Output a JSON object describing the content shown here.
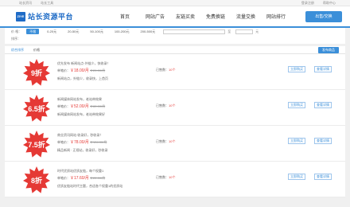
{
  "topbar": {
    "left": [
      "站长资讯",
      "站长工具"
    ],
    "right": [
      "登录注册",
      "帮助中心"
    ]
  },
  "header": {
    "logo_mark": "ZIYE",
    "logo_text": "站长资源平台",
    "nav": [
      "首页",
      "网站广告",
      "友链买卖",
      "免费换链",
      "流量交换",
      "网站排行"
    ],
    "publish_label": "出售/交换"
  },
  "filter": {
    "price_label": "价 格：",
    "price_options": [
      "不限",
      "0-20元",
      "20-50元",
      "50-100元",
      "100-200元",
      "200-500元"
    ],
    "active_index": 0,
    "range_sep": "至",
    "unit": "元",
    "sort_label": "排序："
  },
  "tabs": {
    "items": [
      "综合排序",
      "价格"
    ],
    "active_index": 0,
    "more_label": "发布商品"
  },
  "listings": [
    {
      "discount": "9折",
      "title": "优先发布 新闻站点·外链少，快收录！",
      "price_label": "单笔价：",
      "price": "￥18.00/月",
      "orig": "￥20.00/月",
      "desc": "新闻站点，外链少，收录快，上首页",
      "orders_label": "已售数：",
      "orders": "10个",
      "btn1": "立即购买",
      "btn2": "查看详情"
    },
    {
      "discount": "6.5折",
      "title": "新闻媒体网站发布，老站带效果",
      "price_label": "单笔价：",
      "price": "￥52.00/月",
      "orig": "￥80.00/月",
      "desc": "新闻媒体网站发布，老站带效果好",
      "orders_label": "已售数：",
      "orders": "10个",
      "btn1": "立即购买",
      "btn2": "查看详情"
    },
    {
      "discount": "7.5折",
      "title": "商业资讯网站·收录好，秒收录！",
      "price_label": "单笔价：",
      "price": "￥78.00/月",
      "orig": "￥104.00/月",
      "desc": "精品新闻 · 正规站，收录好，秒收录",
      "orders_label": "已售数：",
      "orders": "10个",
      "btn1": "立即购买",
      "btn2": "查看详情"
    },
    {
      "discount": "8折",
      "title": "时代优质站优质友链，每个权重1",
      "price_label": "单笔价：",
      "price": "￥17.60/月",
      "orig": "￥22.00/月",
      "desc": "优质友链站时代主题，合适各个权重1的优质站",
      "orders_label": "已售数：",
      "orders": "10个",
      "btn1": "立即购买",
      "btn2": "查看详情"
    }
  ],
  "colors": {
    "accent": "#3b8fd9",
    "badge": "#e53935",
    "price": "#e53935"
  }
}
